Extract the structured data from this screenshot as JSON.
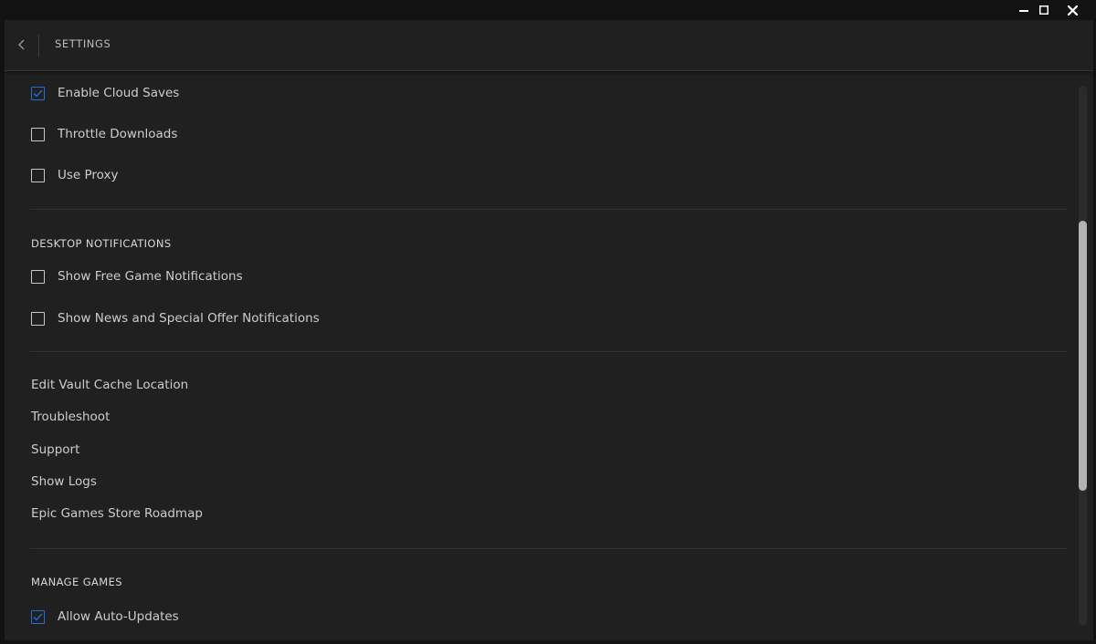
{
  "window": {
    "controls": {
      "minimize_icon": "minimize-icon",
      "maximize_icon": "maximize-icon",
      "close_icon": "close-icon"
    }
  },
  "header": {
    "back_icon": "chevron-left-icon",
    "title": "SETTINGS"
  },
  "general_options": [
    {
      "label": "Enable Cloud Saves",
      "checked": true
    },
    {
      "label": "Throttle Downloads",
      "checked": false
    },
    {
      "label": "Use Proxy",
      "checked": false
    }
  ],
  "desktop_notifications": {
    "title": "DESKTOP NOTIFICATIONS",
    "options": [
      {
        "label": "Show Free Game Notifications",
        "checked": false
      },
      {
        "label": "Show News and Special Offer Notifications",
        "checked": false
      }
    ]
  },
  "links": [
    {
      "label": "Edit Vault Cache Location"
    },
    {
      "label": "Troubleshoot"
    },
    {
      "label": "Support"
    },
    {
      "label": "Show Logs"
    },
    {
      "label": "Epic Games Store Roadmap"
    }
  ],
  "manage_games": {
    "title": "MANAGE GAMES",
    "options": [
      {
        "label": "Allow Auto-Updates",
        "checked": true
      }
    ]
  },
  "scrollbar": {
    "position_fraction": 0.5,
    "visible_fraction": 0.5
  },
  "colors": {
    "accent": "#1f6fd6",
    "background": "#202020",
    "window_frame": "#121212"
  }
}
